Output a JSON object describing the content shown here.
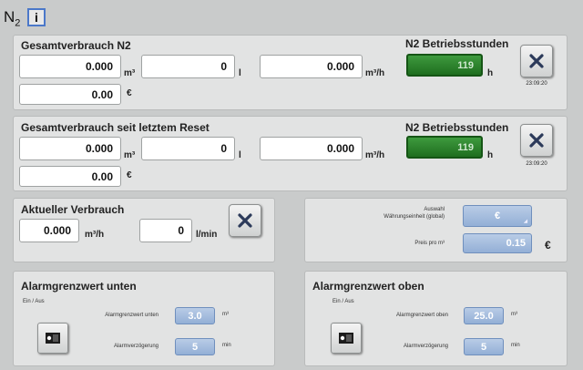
{
  "header": {
    "title": "N",
    "title_sub": "2",
    "info_label": "i"
  },
  "total": {
    "title": "Gesamtverbrauch N2",
    "value_m3": "0.000",
    "unit_m3": "m³",
    "value_l": "0",
    "unit_l": "l",
    "value_flow": "0.000",
    "unit_flow": "m³/h",
    "cost": "0.00",
    "unit_cost": "€",
    "hours_title": "N2 Betriebsstunden",
    "hours": "119",
    "unit_hours": "h",
    "reset_time": "23:09:20"
  },
  "since_reset": {
    "title": "Gesamtverbrauch seit letztem Reset",
    "value_m3": "0.000",
    "unit_m3": "m³",
    "value_l": "0",
    "unit_l": "l",
    "value_flow": "0.000",
    "unit_flow": "m³/h",
    "cost": "0.00",
    "unit_cost": "€",
    "hours_title": "N2 Betriebsstunden",
    "hours": "119",
    "unit_hours": "h",
    "reset_time": "23:09:20"
  },
  "current": {
    "title": "Aktueller Verbrauch",
    "value_flow": "0.000",
    "unit_flow": "m³/h",
    "value_lmin": "0",
    "unit_lmin": "l/min"
  },
  "currency": {
    "select_label_1": "Auswahl",
    "select_label_2": "Währungseinheit (global)",
    "selected": "€",
    "price_label": "Preis pro m³",
    "price": "0.15",
    "price_unit": "€"
  },
  "alarm_low": {
    "title": "Alarmgrenzwert unten",
    "switch_label": "Ein / Aus",
    "limit_label": "Alarmgrenzwert unten",
    "limit_value": "3.0",
    "limit_unit": "m³",
    "delay_label": "Alarmverzögerung",
    "delay_value": "5",
    "delay_unit": "min"
  },
  "alarm_high": {
    "title": "Alarmgrenzwert oben",
    "switch_label": "Ein / Aus",
    "limit_label": "Alarmgrenzwert oben",
    "limit_value": "25.0",
    "limit_unit": "m³",
    "delay_label": "Alarmverzögerung",
    "delay_value": "5",
    "delay_unit": "min"
  }
}
